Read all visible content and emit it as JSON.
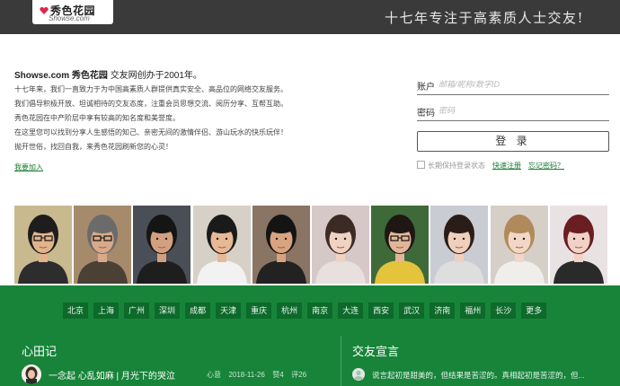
{
  "header": {
    "logo_cn": "秀色花园",
    "logo_en": "Showse.com",
    "slogan": "十七年专注于高素质人士交友!"
  },
  "intro": {
    "brand": "Showse.com 秀色花园",
    "founded": "交友网创办于2001年。",
    "lines": [
      "十七年来，我们一直致力于为中国高素质人群提供真实安全、高品位的网络交友服务。",
      "我们倡导积极开放、坦诚相待的交友态度，注重会员思想交流、阅历分享、互帮互助。",
      "秀色花园在中产阶层中享有较高的知名度和美誉度。",
      "在这里您可以找到分享人生感悟的知己、亲密无间的激情伴侣、游山玩水的快乐玩伴！",
      "抛开世俗，找回自我，来秀色花园刷新您的心灵！"
    ],
    "join_label": "我要加入"
  },
  "login": {
    "account_label": "账户",
    "account_placeholder": "邮箱/昵称/数字ID",
    "password_label": "密码",
    "password_placeholder": "密码",
    "submit_label": "登 录",
    "remember_label": "长期保持登录状态",
    "register_link": "快速注册",
    "forgot_link": "忘记密码？"
  },
  "members": [
    {
      "bg": "#c9b98f",
      "skin": "#e2b48c",
      "hair": "#1d1d1d",
      "shirt": "#2d2d2d",
      "glasses": true
    },
    {
      "bg": "#a58a6b",
      "skin": "#d9a989",
      "hair": "#6b6b6b",
      "shirt": "#4a4036",
      "glasses": true
    },
    {
      "bg": "#4a4e56",
      "skin": "#d2a080",
      "hair": "#151515",
      "shirt": "#1e1e1e",
      "glasses": false
    },
    {
      "bg": "#d6d0c6",
      "skin": "#e7b896",
      "hair": "#1a1a1a",
      "shirt": "#f2f2f2",
      "glasses": false
    },
    {
      "bg": "#8a7464",
      "skin": "#d8a37f",
      "hair": "#141414",
      "shirt": "#222222",
      "glasses": false
    },
    {
      "bg": "#d7c8c8",
      "skin": "#f0d2c2",
      "hair": "#3c2a24",
      "shirt": "#e8e0dc",
      "glasses": false
    },
    {
      "bg": "#3e6a3a",
      "skin": "#e3b699",
      "hair": "#1f1713",
      "shirt": "#e3c43a",
      "glasses": true
    },
    {
      "bg": "#c9ccd2",
      "skin": "#f0d0bd",
      "hair": "#2a1d17",
      "shirt": "#dedede",
      "glasses": false
    },
    {
      "bg": "#d5cfc8",
      "skin": "#f2d6c6",
      "hair": "#b08a5a",
      "shirt": "#f0eeea",
      "glasses": false
    },
    {
      "bg": "#e9e2e3",
      "skin": "#f2d2c6",
      "hair": "#6a1e22",
      "shirt": "#2a2a2a",
      "glasses": false
    }
  ],
  "cities": [
    "北京",
    "上海",
    "广州",
    "深圳",
    "成都",
    "天津",
    "重庆",
    "杭州",
    "南京",
    "大连",
    "西安",
    "武汉",
    "济南",
    "福州",
    "长沙",
    "更多"
  ],
  "diary": {
    "title": "心田记",
    "post_title": "一念起 心乱如麻 | 月光下的哭泣",
    "post_author": "心意",
    "post_date": "2018-11-26",
    "post_likes": "赞4",
    "post_comments": "评26"
  },
  "declaration": {
    "title": "交友宣言",
    "text": "说言起初是甜美的，但结果是苦涩的。真相起初是苦涩的，但..."
  },
  "colors": {
    "header_bg": "#3a3a3a",
    "green_bg": "#17843a",
    "city_bg": "#0d6a2b",
    "link_green": "#1c7a36"
  }
}
